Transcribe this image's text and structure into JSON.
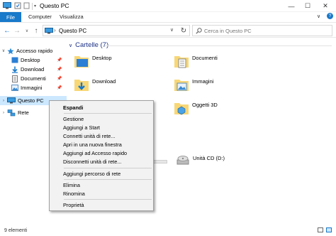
{
  "window": {
    "title": "Questo PC",
    "minimize": "—",
    "maximize": "☐",
    "close": "✕"
  },
  "ribbon": {
    "tabs": [
      "File",
      "Computer",
      "Visualizza"
    ],
    "expand": "∨",
    "help": "?"
  },
  "address": {
    "crumb": "Questo PC",
    "separator": "›",
    "search_placeholder": "Cerca in Questo PC"
  },
  "sidebar": {
    "items": [
      {
        "label": "Accesso rapido",
        "icon": "star-icon"
      },
      {
        "label": "Desktop",
        "icon": "desktop-folder-icon"
      },
      {
        "label": "Download",
        "icon": "download-folder-icon"
      },
      {
        "label": "Documenti",
        "icon": "documents-folder-icon"
      },
      {
        "label": "Immagini",
        "icon": "pictures-folder-icon"
      },
      {
        "label": "Questo PC",
        "icon": "pc-icon"
      },
      {
        "label": "Rete",
        "icon": "network-icon"
      }
    ]
  },
  "main": {
    "group_title": "Cartelle (7)",
    "folders": [
      {
        "label": "Desktop",
        "icon": "desktop-folder-icon"
      },
      {
        "label": "Documenti",
        "icon": "documents-folder-icon"
      },
      {
        "label": "Download",
        "icon": "download-folder-icon"
      },
      {
        "label": "Immagini",
        "icon": "pictures-folder-icon"
      },
      {
        "label": "Oggetti 3D",
        "icon": "3d-objects-folder-icon"
      }
    ],
    "drive_label": "Unità CD (D:)"
  },
  "status": {
    "items_count": "9 elementi"
  },
  "context_menu": {
    "items": [
      "Espandi",
      "Gestione",
      "Aggiungi a Start",
      "Connetti unità di rete...",
      "Apri in una nuova finestra",
      "Aggiungi ad Accesso rapido",
      "Disconnetti unità di rete...",
      "Aggiungi percorso di rete",
      "Elimina",
      "Rinomina",
      "Proprietà"
    ]
  },
  "colors": {
    "file_tab": "#1979ca",
    "selection": "#cce8ff",
    "group_header": "#1e3287",
    "folder_yellow": "#f8d775"
  }
}
